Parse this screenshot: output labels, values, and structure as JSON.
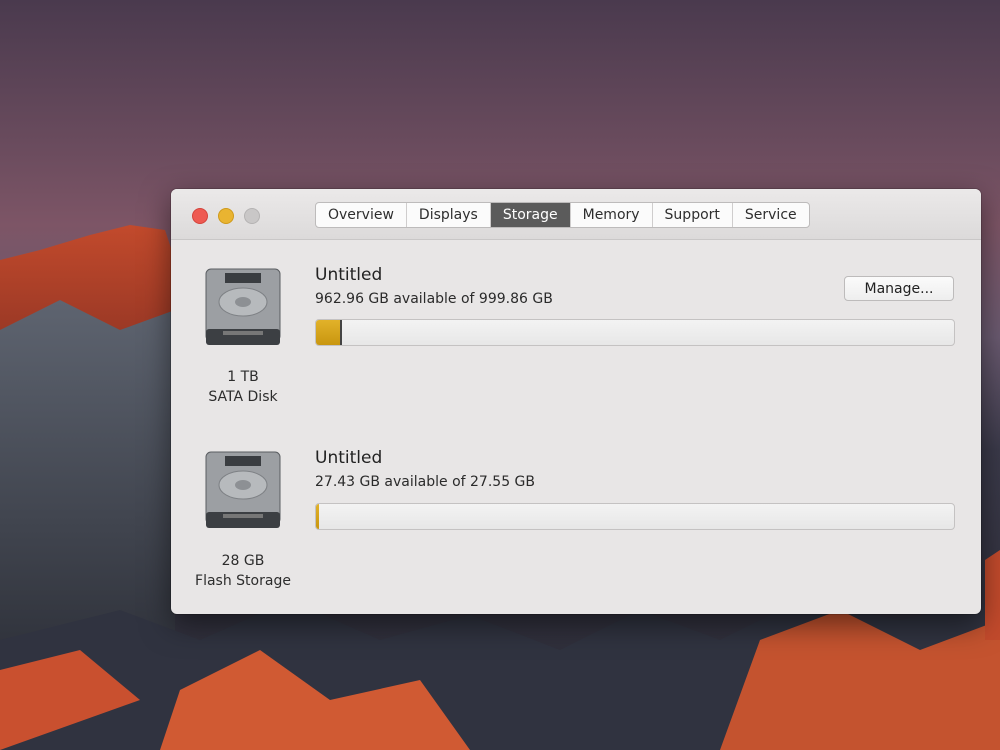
{
  "window": {
    "tabs": [
      {
        "label": "Overview"
      },
      {
        "label": "Displays"
      },
      {
        "label": "Storage",
        "active": true
      },
      {
        "label": "Memory"
      },
      {
        "label": "Support"
      },
      {
        "label": "Service"
      }
    ]
  },
  "disks": [
    {
      "capacity": "1 TB",
      "type": "SATA Disk",
      "volume_name": "Untitled",
      "availability": "962.96 GB available of 999.86 GB",
      "used_fraction": 0.037,
      "manage_label": "Manage..."
    },
    {
      "capacity": "28 GB",
      "type": "Flash Storage",
      "volume_name": "Untitled",
      "availability": "27.43 GB available of 27.55 GB",
      "used_fraction": 0.004
    }
  ],
  "colors": {
    "used_bar": "#d9a81d",
    "active_tab": "#5b5b5b",
    "close": "#ee5a52",
    "minimize": "#e9b431",
    "zoom": "#c9c7c7"
  }
}
